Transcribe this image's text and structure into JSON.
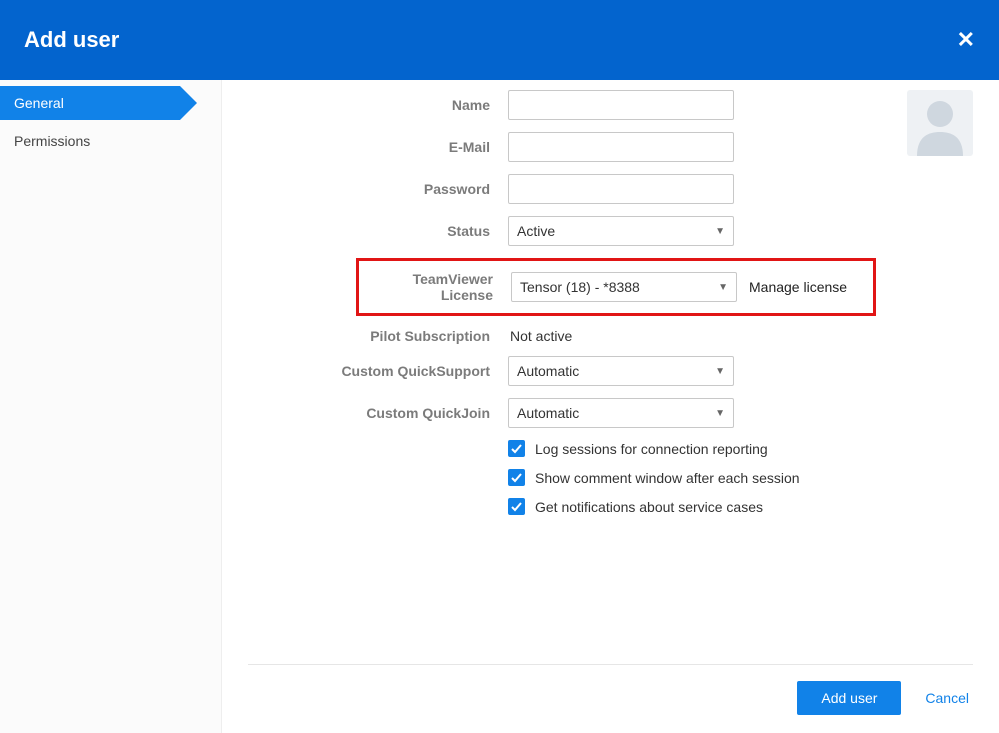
{
  "header": {
    "title": "Add user"
  },
  "sidebar": {
    "tabs": [
      {
        "label": "General",
        "active": true
      },
      {
        "label": "Permissions",
        "active": false
      }
    ]
  },
  "form": {
    "name": {
      "label": "Name",
      "value": ""
    },
    "email": {
      "label": "E-Mail",
      "value": ""
    },
    "password": {
      "label": "Password",
      "value": ""
    },
    "status": {
      "label": "Status",
      "value": "Active"
    },
    "license": {
      "label": "TeamViewer License",
      "value": "Tensor (18) - *8388",
      "manage": "Manage license"
    },
    "pilot": {
      "label": "Pilot Subscription",
      "value": "Not active"
    },
    "cqs": {
      "label": "Custom QuickSupport",
      "value": "Automatic"
    },
    "cqj": {
      "label": "Custom QuickJoin",
      "value": "Automatic"
    },
    "checks": {
      "log": "Log sessions for connection reporting",
      "comment": "Show comment window after each session",
      "notify": "Get notifications about service cases"
    }
  },
  "footer": {
    "primary": "Add user",
    "cancel": "Cancel"
  }
}
